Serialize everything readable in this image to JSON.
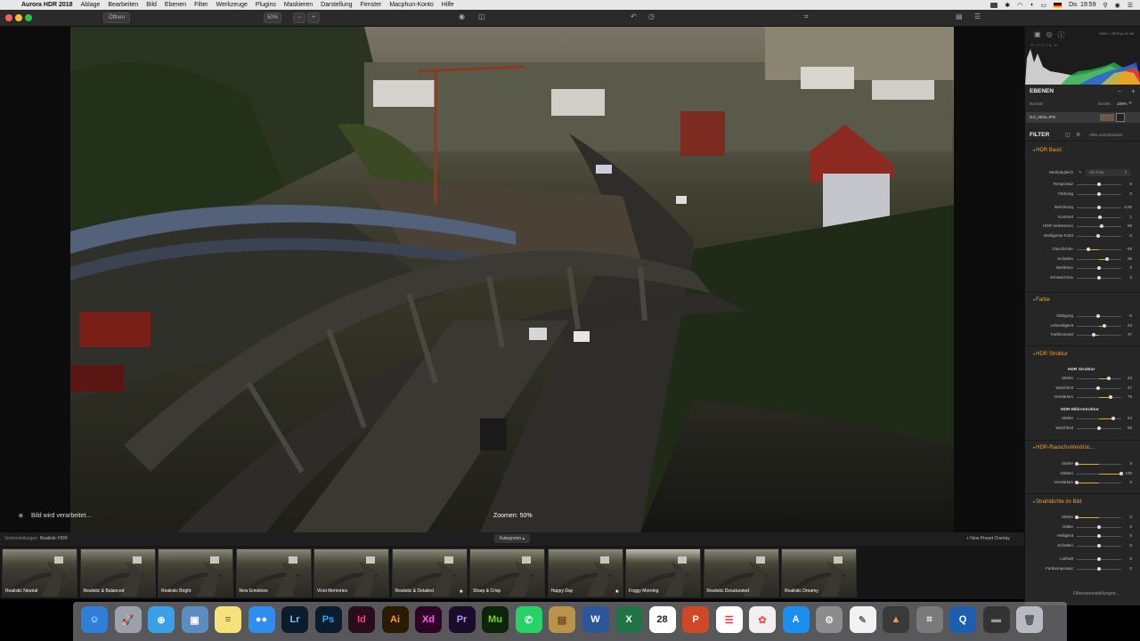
{
  "menubar": {
    "apple": "",
    "app_name": "Aurora HDR 2018",
    "items": [
      "Ablage",
      "Bearbeiten",
      "Bild",
      "Ebenen",
      "Filter",
      "Werkzeuge",
      "Plugins",
      "Maskieren",
      "Darstellung",
      "Fenster",
      "Macphun-Konto",
      "Hilfe"
    ],
    "clock": "Do. 19:59"
  },
  "toolbar": {
    "open_label": "Öffnen",
    "zoom_value": "50%",
    "zoom_minus": "−",
    "zoom_plus": "+"
  },
  "canvas": {
    "status": "Bild wird verarbeitet...",
    "zoom_status": "Zoomen: 50%"
  },
  "histogram": {
    "info": "5968 × 2976 px   32-bit",
    "values": "Rt -17   G -2   B -10"
  },
  "layers": {
    "title": "EBENEN",
    "blend": "Normal",
    "opacity_label": "Deckkr.",
    "opacity_value": "100%",
    "file_name": "DJI_0034.JPG"
  },
  "filters": {
    "title": "FILTER",
    "reset_all": "Alles zurücksetzen",
    "groups": [
      {
        "name": "HDR Basic",
        "white_balance_label": "Weißabgleich",
        "white_balance_value": "Als Foto",
        "rows": [
          {
            "label": "Temperatur",
            "value": "0",
            "pos": 0.5
          },
          {
            "label": "Färbung",
            "value": "0",
            "pos": 0.5
          },
          {
            "label": "Belichtung",
            "value": "0,00",
            "pos": 0.5
          },
          {
            "label": "Kontrast",
            "value": "1",
            "pos": 0.51
          },
          {
            "label": "HDR-Verbessern",
            "value": "56",
            "pos": 0.56
          },
          {
            "label": "Intelligente Farbt",
            "value": "-3",
            "pos": 0.48
          },
          {
            "label": "Glanzlichter",
            "value": "-48",
            "pos": 0.26
          },
          {
            "label": "Schatten",
            "value": "36",
            "pos": 0.68
          },
          {
            "label": "Weißtöne",
            "value": "0",
            "pos": 0.5
          },
          {
            "label": "Schwarztöne",
            "value": "0",
            "pos": 0.5
          }
        ]
      },
      {
        "name": "Farbe",
        "rows": [
          {
            "label": "Sättigung",
            "value": "-6",
            "pos": 0.47
          },
          {
            "label": "Lebendigkeit",
            "value": "23",
            "pos": 0.62
          },
          {
            "label": "Farbkontrast",
            "value": "37",
            "pos": 0.37
          }
        ]
      },
      {
        "name": "HDR Struktur",
        "sub1": "HDR Struktur",
        "rows1": [
          {
            "label": "Stärke",
            "value": "43",
            "pos": 0.72
          },
          {
            "label": "Weichheit",
            "value": "47",
            "pos": 0.47
          },
          {
            "label": "Verstärken",
            "value": "76",
            "pos": 0.76
          }
        ],
        "sub2": "HDR-Mikrostruktur",
        "rows2": [
          {
            "label": "Stärke",
            "value": "64",
            "pos": 0.82
          },
          {
            "label": "Weichheit",
            "value": "50",
            "pos": 0.5
          }
        ]
      },
      {
        "name": "HDR-Rauschunterdrüc...",
        "rows": [
          {
            "label": "Stärke",
            "value": "0",
            "pos": 0.0
          },
          {
            "label": "Glätten",
            "value": "100",
            "pos": 1.0
          },
          {
            "label": "Verstärken",
            "value": "0",
            "pos": 0.0
          }
        ]
      },
      {
        "name": "Strahldichte im Bild",
        "rows": [
          {
            "label": "Stärke",
            "value": "0",
            "pos": 0.0
          },
          {
            "label": "Glätte",
            "value": "0",
            "pos": 0.5
          },
          {
            "label": "Helligkeit",
            "value": "0",
            "pos": 0.5
          },
          {
            "label": "Schatten",
            "value": "0",
            "pos": 0.5
          },
          {
            "label": "Lebhaft",
            "value": "0",
            "pos": 0.5
          },
          {
            "label": "Farbtemperatur",
            "value": "0",
            "pos": 0.5
          }
        ]
      }
    ],
    "footer": "Filtervoreinstellungen..."
  },
  "presets": {
    "current_label": "Voreinstellungen:",
    "current_value": "Realistic HDR",
    "categories": "Kategorien ▴",
    "new_preset": "+ New Preset Overlay",
    "items": [
      {
        "name": "Realistic Neutral",
        "star": ""
      },
      {
        "name": "Realistic & Balanced",
        "star": ""
      },
      {
        "name": "Realistic Bright",
        "star": ""
      },
      {
        "name": "New Emotions",
        "star": ""
      },
      {
        "name": "Vivid Memories",
        "star": ""
      },
      {
        "name": "Realistic & Detailed",
        "star": "★"
      },
      {
        "name": "Sharp & Crisp",
        "star": ""
      },
      {
        "name": "Happy Day",
        "star": "★"
      },
      {
        "name": "Foggy Morning",
        "star": ""
      },
      {
        "name": "Realistic Desaturated",
        "star": ""
      },
      {
        "name": "Realistic Dreamy",
        "star": ""
      }
    ]
  },
  "dock": {
    "items": [
      {
        "name": "finder-icon",
        "text": "☺",
        "bg": "#2f7fd8",
        "fg": "#fff"
      },
      {
        "name": "launchpad-icon",
        "text": "🚀",
        "bg": "#9aa3ad",
        "fg": "#fff"
      },
      {
        "name": "safari-icon",
        "text": "⊕",
        "bg": "#3aa0e8",
        "fg": "#fff"
      },
      {
        "name": "preview-icon",
        "text": "▣",
        "bg": "#5b8cc2",
        "fg": "#fff"
      },
      {
        "name": "notes-icon",
        "text": "≡",
        "bg": "#f6e27a",
        "fg": "#555"
      },
      {
        "name": "messages-icon",
        "text": "●●",
        "bg": "#2d8ef0",
        "fg": "#fff"
      },
      {
        "name": "lightroom-icon",
        "text": "Lr",
        "bg": "#0b1c2c",
        "fg": "#7bc4f6"
      },
      {
        "name": "photoshop-icon",
        "text": "Ps",
        "bg": "#0b1c2c",
        "fg": "#31a8ff"
      },
      {
        "name": "indesign-icon",
        "text": "Id",
        "bg": "#2a0d1b",
        "fg": "#ff3c8e"
      },
      {
        "name": "illustrator-icon",
        "text": "Ai",
        "bg": "#2b1a03",
        "fg": "#ff9a00"
      },
      {
        "name": "xd-icon",
        "text": "Xd",
        "bg": "#2e0426",
        "fg": "#ff61f6"
      },
      {
        "name": "premiere-icon",
        "text": "Pr",
        "bg": "#1b0c2c",
        "fg": "#b695ff"
      },
      {
        "name": "muse-icon",
        "text": "Mu",
        "bg": "#0c2407",
        "fg": "#6ee01b"
      },
      {
        "name": "whatsapp-icon",
        "text": "✆",
        "bg": "#25d366",
        "fg": "#fff"
      },
      {
        "name": "archive-icon",
        "text": "▤",
        "bg": "#b9924c",
        "fg": "#6b4b18"
      },
      {
        "name": "word-icon",
        "text": "W",
        "bg": "#2b579a",
        "fg": "#fff"
      },
      {
        "name": "excel-icon",
        "text": "X",
        "bg": "#217346",
        "fg": "#fff"
      },
      {
        "name": "calendar-icon",
        "text": "28",
        "bg": "#ffffff",
        "fg": "#222"
      },
      {
        "name": "powerpoint-icon",
        "text": "P",
        "bg": "#d24726",
        "fg": "#fff"
      },
      {
        "name": "reminders-icon",
        "text": "☰",
        "bg": "#ffffff",
        "fg": "#e34"
      },
      {
        "name": "photos-icon",
        "text": "✿",
        "bg": "#f0f0f0",
        "fg": "#e55"
      },
      {
        "name": "app-store-icon",
        "text": "A",
        "bg": "#1a8ff0",
        "fg": "#fff"
      },
      {
        "name": "system-preferences-icon",
        "text": "⚙",
        "bg": "#8c8c8c",
        "fg": "#eee"
      },
      {
        "name": "textedit-icon",
        "text": "✎",
        "bg": "#f2f2f2",
        "fg": "#666"
      },
      {
        "name": "aurora-hdr-icon",
        "text": "▲",
        "bg": "#3a3a3a",
        "fg": "#f2a23b"
      },
      {
        "name": "screenshot-icon",
        "text": "⌗",
        "bg": "#7a7a7a",
        "fg": "#eee"
      },
      {
        "name": "quicktime-icon",
        "text": "Q",
        "bg": "#1c5fae",
        "fg": "#fff"
      },
      {
        "name": "downloads-folder-icon",
        "text": "▬",
        "bg": "#333",
        "fg": "#999"
      },
      {
        "name": "trash-icon",
        "text": "🗑",
        "bg": "#b8bcc2",
        "fg": "#555"
      }
    ]
  }
}
